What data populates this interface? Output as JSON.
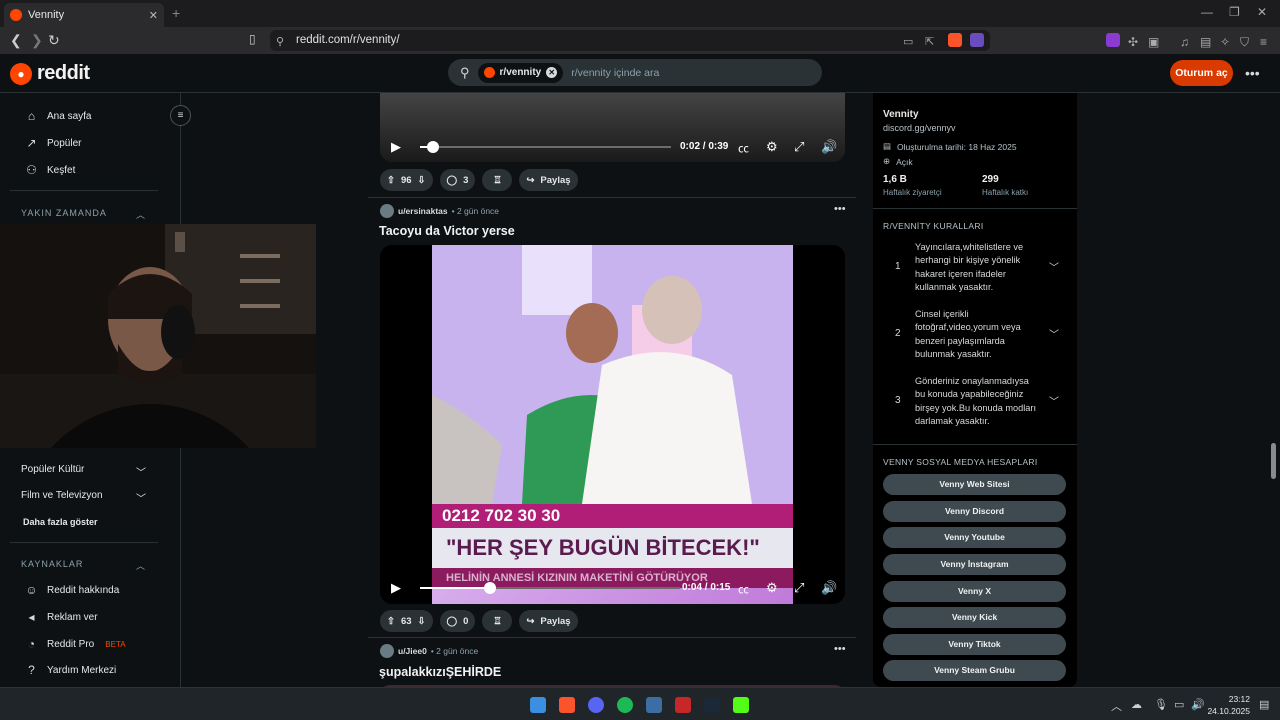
{
  "browser": {
    "tab_title": "Vennity",
    "url": "reddit.com/r/vennity/"
  },
  "header": {
    "logo_text": "reddit",
    "search_chip": "r/vennity",
    "search_placeholder": "r/vennity içinde ara",
    "login_label": "Oturum aç"
  },
  "sidebar": {
    "items": [
      {
        "label": "Ana sayfa",
        "icon": "home-icon"
      },
      {
        "label": "Popüler",
        "icon": "popular-icon"
      },
      {
        "label": "Keşfet",
        "icon": "explore-icon"
      }
    ],
    "recent_header": "YAKIN ZAMANDA",
    "topics": [
      {
        "label": "Popüler Kültür"
      },
      {
        "label": "Film ve Televizyon"
      }
    ],
    "show_more": "Daha fazla göster",
    "resources_header": "KAYNAKLAR",
    "resources": [
      {
        "label": "Reddit hakkında",
        "icon": "reddit-icon"
      },
      {
        "label": "Reklam ver",
        "icon": "megaphone-icon"
      },
      {
        "label": "Reddit Pro",
        "badge": "BETA",
        "icon": "pro-icon"
      },
      {
        "label": "Yardım Merkezi",
        "icon": "help-icon"
      }
    ]
  },
  "posts": [
    {
      "video_time": "0:02 / 0:39",
      "video_progress": 0.05,
      "votes": "96",
      "comments": "3",
      "share_label": "Paylaş"
    },
    {
      "user": "u/ersinaktas",
      "time": "• 2 gün önce",
      "title": "Tacoyu da Victor yerse",
      "video_time": "0:04 / 0:15",
      "video_progress": 0.27,
      "banner_phone": "0212 702 30 30",
      "banner_main": "\"HER ŞEY BUGÜN BİTECEK!\"",
      "banner_sub": "HELİNİN ANNESİ KIZININ MAKETİNİ GÖTÜRÜYOR",
      "votes": "63",
      "comments": "0",
      "share_label": "Paylaş"
    },
    {
      "user": "u/Jiee0",
      "time": "• 2 gün önce",
      "title": "şupalakkızıŞEHİRDE"
    }
  ],
  "community": {
    "name": "Vennity",
    "link": "discord.gg/vennyv",
    "created": "Oluşturulma tarihi: 18 Haz 2025",
    "visibility": "Açık",
    "weekly_visitors": "1,6 B",
    "weekly_visitors_label": "Haftalık ziyaretçi",
    "weekly_contrib": "299",
    "weekly_contrib_label": "Haftalık katkı",
    "rules_header": "R/VENNİTY KURALLARI",
    "rules": [
      {
        "num": "1",
        "text": "Yayıncılara,whitelistlere ve herhangi bir kişiye yönelik hakaret içeren ifadeler kullanmak yasaktır."
      },
      {
        "num": "2",
        "text": "Cinsel içerikli fotoğraf,video,yorum veya benzeri paylaşımlarda bulunmak yasaktır."
      },
      {
        "num": "3",
        "text": "Gönderiniz onaylanmadıysa bu konuda yapabileceğiniz birşey yok.Bu konuda modları darlamak yasaktır."
      }
    ],
    "social_header": "VENNY SOSYAL MEDYA HESAPLARI",
    "social_buttons": [
      "Venny Web Sitesi",
      "Venny Discord",
      "Venny Youtube",
      "Venny İnstagram",
      "Venny X",
      "Venny Kick",
      "Venny Tiktok",
      "Venny Steam Grubu"
    ]
  },
  "taskbar": {
    "time": "23:12",
    "date": "24.10.2025"
  },
  "colors": {
    "accent": "#ff4500",
    "login_bg": "#d93a00",
    "background": "#0e1113"
  }
}
